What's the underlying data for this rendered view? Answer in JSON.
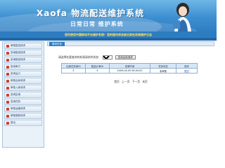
{
  "header": {
    "brand": "Xaofa 物流配送维护系统",
    "slogan": "日常日常 维护系统",
    "notice": "您所使用中国移动平台维护系统！您的操作将会被记录在系统维护日志"
  },
  "sidebar": {
    "items": [
      {
        "label": "审核配送请求"
      },
      {
        "label": "查询配送请求"
      },
      {
        "label": "查询配送请求"
      },
      {
        "label": "查询审方"
      },
      {
        "label": "查询运力"
      },
      {
        "label": "审核出库请求"
      },
      {
        "label": "审核入库请求"
      },
      {
        "label": "查询区域"
      },
      {
        "label": "查询任务"
      },
      {
        "label": "审核运输请求"
      },
      {
        "label": "审核退款请求"
      },
      {
        "label": "退出"
      }
    ]
  },
  "main": {
    "tab": "需求任务",
    "filter": {
      "label": "请选择在要查询的处理请求的状态：",
      "selected": "未",
      "button": "查询出库请求"
    },
    "table": {
      "headers": [
        "出库任务单ID",
        "配送计单ID",
        "发单时间",
        "任务状态",
        "操作"
      ],
      "rows": [
        [
          "5",
          "5",
          "2009-04-09 06:00:00",
          "未审核",
          "提交"
        ]
      ]
    },
    "pager": {
      "first": "首页",
      "prev": "上一页",
      "next": "下一页",
      "last": "末页"
    }
  },
  "colors": {
    "banner": "#3d8fd0",
    "notice_text": "#ffe35a",
    "sidebar_bullet": "#d23c2a",
    "table_header": "#d7e6f5"
  }
}
